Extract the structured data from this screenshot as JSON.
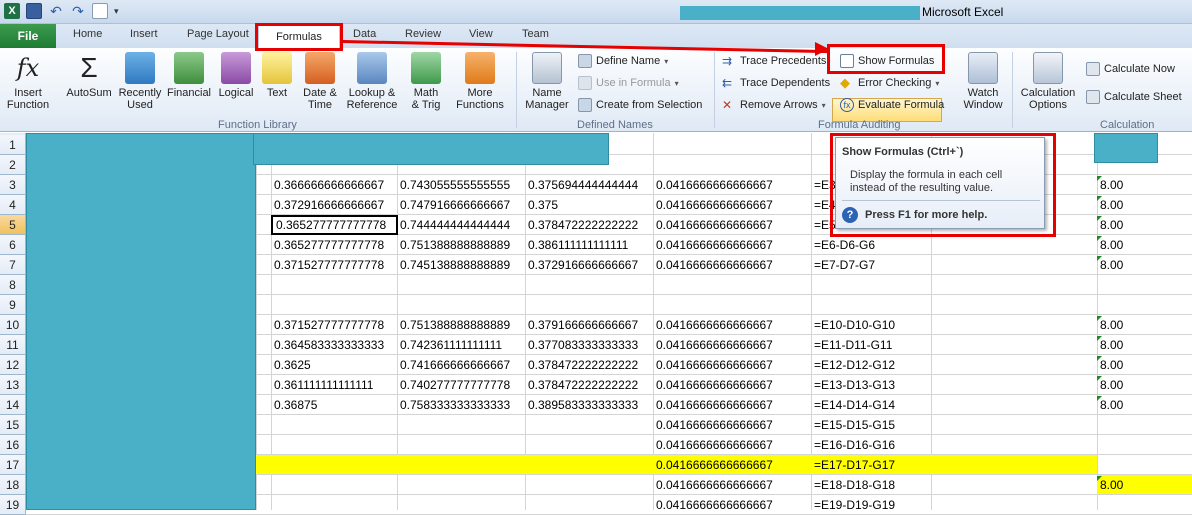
{
  "window": {
    "title": "Microsoft Excel"
  },
  "tabs": {
    "file": "File",
    "items": [
      "Home",
      "Insert",
      "Page Layout",
      "Formulas",
      "Data",
      "Review",
      "View",
      "Team"
    ],
    "active": "Formulas"
  },
  "ribbon": {
    "function_library": {
      "label": "Function Library",
      "buttons": [
        "Insert\nFunction",
        "AutoSum",
        "Recently\nUsed",
        "Financial",
        "Logical",
        "Text",
        "Date &\nTime",
        "Lookup &\nReference",
        "Math\n& Trig",
        "More\nFunctions"
      ]
    },
    "defined_names": {
      "label": "Defined Names",
      "name_manager": "Name\nManager",
      "define_name": "Define Name",
      "use_in_formula": "Use in Formula",
      "create_from_selection": "Create from Selection"
    },
    "formula_auditing": {
      "label": "Formula Auditing",
      "trace_precedents": "Trace Precedents",
      "trace_dependents": "Trace Dependents",
      "remove_arrows": "Remove Arrows",
      "show_formulas": "Show Formulas",
      "error_checking": "Error Checking",
      "evaluate_formula": "Evaluate Formula",
      "watch_window": "Watch\nWindow"
    },
    "calculation": {
      "label": "Calculation",
      "calculation_options": "Calculation\nOptions",
      "calculate_now": "Calculate Now",
      "calculate_sheet": "Calculate Sheet"
    }
  },
  "tooltip": {
    "title": "Show Formulas (Ctrl+`)",
    "description": "Display the formula in each cell instead of the resulting value.",
    "help": "Press F1 for more help."
  },
  "grid": {
    "rows": [
      "1",
      "2",
      "3",
      "4",
      "5",
      "6",
      "7",
      "8",
      "9",
      "10",
      "11",
      "12",
      "13",
      "14",
      "15",
      "16",
      "17",
      "18",
      "19"
    ],
    "selected_row": "5",
    "cells": [
      {
        "r": 3,
        "b": "0.366666666666667",
        "c": "0.743055555555555",
        "d": "0.375694444444444",
        "e": "0.0416666666666667",
        "f": "=E3-D3-G3",
        "h": "8.00"
      },
      {
        "r": 4,
        "b": "0.372916666666667",
        "c": "0.747916666666667",
        "d": "0.375",
        "e": "0.0416666666666667",
        "f": "=E4-D4-G4",
        "h": "8.00"
      },
      {
        "r": 5,
        "b": "0.365277777777778",
        "c": "0.744444444444444",
        "d": "0.378472222222222",
        "e": "0.0416666666666667",
        "f": "=E5-D5-G5",
        "h": "8.00"
      },
      {
        "r": 6,
        "b": "0.365277777777778",
        "c": "0.751388888888889",
        "d": "0.386111111111111",
        "e": "0.0416666666666667",
        "f": "=E6-D6-G6",
        "h": "8.00"
      },
      {
        "r": 7,
        "b": "0.371527777777778",
        "c": "0.745138888888889",
        "d": "0.372916666666667",
        "e": "0.0416666666666667",
        "f": "=E7-D7-G7",
        "h": "8.00"
      },
      {
        "r": 10,
        "b": "0.371527777777778",
        "c": "0.751388888888889",
        "d": "0.379166666666667",
        "e": "0.0416666666666667",
        "f": "=E10-D10-G10",
        "h": "8.00"
      },
      {
        "r": 11,
        "b": "0.364583333333333",
        "c": "0.742361111111111",
        "d": "0.377083333333333",
        "e": "0.0416666666666667",
        "f": "=E11-D11-G11",
        "h": "8.00"
      },
      {
        "r": 12,
        "b": "0.3625",
        "c": "0.741666666666667",
        "d": "0.378472222222222",
        "e": "0.0416666666666667",
        "f": "=E12-D12-G12",
        "h": "8.00"
      },
      {
        "r": 13,
        "b": "0.361111111111111",
        "c": "0.740277777777778",
        "d": "0.378472222222222",
        "e": "0.0416666666666667",
        "f": "=E13-D13-G13",
        "h": "8.00"
      },
      {
        "r": 14,
        "b": "0.36875",
        "c": "0.758333333333333",
        "d": "0.389583333333333",
        "e": "0.0416666666666667",
        "f": "=E14-D14-G14",
        "h": "8.00"
      },
      {
        "r": 15,
        "b": "",
        "c": "",
        "d": "",
        "e": "0.0416666666666667",
        "f": "=E15-D15-G15",
        "h": ""
      },
      {
        "r": 16,
        "b": "",
        "c": "",
        "d": "",
        "e": "0.0416666666666667",
        "f": "=E16-D16-G16",
        "h": ""
      },
      {
        "r": 17,
        "b": "",
        "c": "",
        "d": "",
        "e": "0.0416666666666667",
        "f": "=E17-D17-G17",
        "h": ""
      },
      {
        "r": 18,
        "b": "",
        "c": "",
        "d": "",
        "e": "0.0416666666666667",
        "f": "=E18-D18-G18",
        "h": "8.00"
      },
      {
        "r": 19,
        "b": "",
        "c": "",
        "d": "",
        "e": "0.0416666666666667",
        "f": "=E19-D19-G19",
        "h": ""
      }
    ],
    "highlight_color": "#ffff00"
  },
  "colors": {
    "annotation_red": "#e60000",
    "redaction": "#4ab0c8",
    "file_tab": "#1d7b33"
  }
}
